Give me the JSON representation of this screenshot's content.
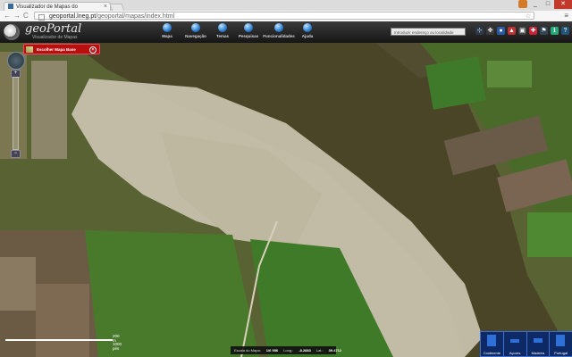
{
  "browser": {
    "tab_title": "Visualizador de Mapas do",
    "tab_close": "×",
    "url_host": "geoportal.lneg.pt",
    "url_path": "/geoportal/mapas/index.html",
    "back_glyph": "←",
    "forward_glyph": "→",
    "reload_glyph": "C",
    "minimize": "_",
    "maximize": "□",
    "close": "✕"
  },
  "app": {
    "brand": "geoPortal",
    "subtitle": "Visualizador de Mapas",
    "menu": [
      {
        "label": "Mapa",
        "icon": "map-icon"
      },
      {
        "label": "Navegação",
        "icon": "navigation-icon"
      },
      {
        "label": "Temas",
        "icon": "layers-icon"
      },
      {
        "label": "Pesquisas",
        "icon": "search-icon"
      },
      {
        "label": "Funcionalidades",
        "icon": "tools-icon"
      },
      {
        "label": "Ajuda",
        "icon": "help-icon"
      }
    ],
    "search_placeholder": "Introduzir endereço ou localidade"
  },
  "map": {
    "base_map_button": "Escolher Mapa Base",
    "close_glyph": "×",
    "zoom_in": "+",
    "zoom_out": "−",
    "scale": {
      "top_label": "200 m",
      "bottom_label": "1000 pés"
    },
    "status": {
      "label_scale": "Escala do Mapa:",
      "scale_value": "1/6 956",
      "label_long": "Long.:",
      "long_value": "-8.2883",
      "label_lat": "Lat.:",
      "lat_value": "39.4712"
    },
    "regions": [
      {
        "label": "Continente"
      },
      {
        "label": "Açores"
      },
      {
        "label": "Madeira"
      },
      {
        "label": "Portugal"
      }
    ]
  },
  "colors": {
    "accent_red": "#b90e0e",
    "toolbar_dark": "#1e1e1e",
    "region_blue": "#0d2a66"
  }
}
